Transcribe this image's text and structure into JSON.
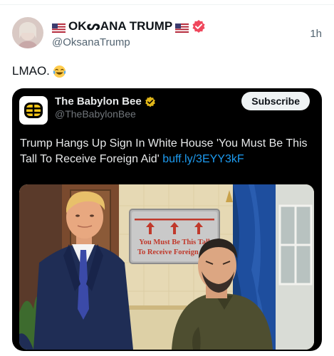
{
  "author": {
    "name": "OKᔕANA TRUMP",
    "handle": "@OksanaTrump",
    "time": "1h",
    "verified": true
  },
  "tweet": {
    "text": "LMAO.",
    "emoji": "tears-of-joy-emoji"
  },
  "quote": {
    "name": "The Babylon Bee",
    "handle": "@TheBabylonBee",
    "subscribe_label": "Subscribe",
    "text": "Trump Hangs Up Sign In White House 'You Must Be This Tall To Receive Foreign Aid'",
    "link": "buff.ly/3EYY3kF",
    "image": {
      "sign_line1": "You Must Be This Tall",
      "sign_line2": "To Receive Foreign Aid"
    }
  },
  "colors": {
    "link": "#1d9bf0",
    "verified_badge": "#f0475c",
    "gold_badge": "#e2b719",
    "sign_red": "#c0392b"
  }
}
